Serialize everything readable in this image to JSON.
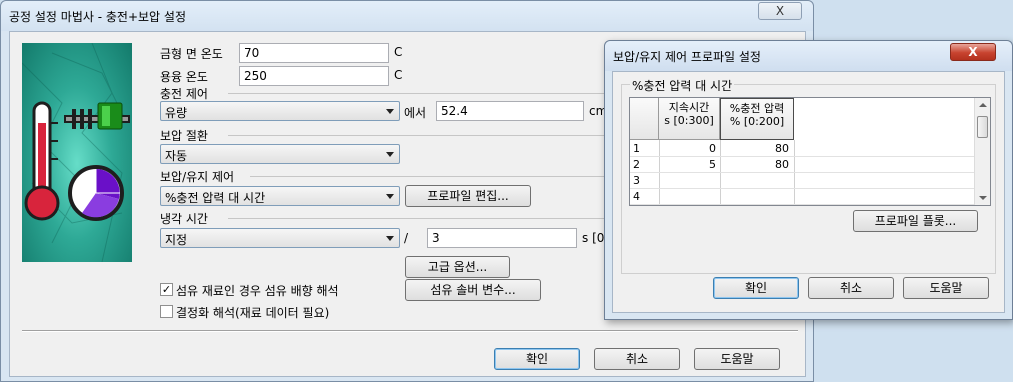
{
  "main_window": {
    "title": "공정 설정 마법사 - 충전+보압 설정",
    "close_label": "X",
    "mold_temp": {
      "label": "금형 면 온도",
      "value": "70",
      "unit": "C"
    },
    "melt_temp": {
      "label": "용융 온도",
      "value": "250",
      "unit": "C"
    },
    "fill_control": {
      "label": "충전 제어",
      "selected": "유량",
      "connector": "에서",
      "value": "52.4",
      "unit": "cm"
    },
    "vp_switch": {
      "label": "보압 절환",
      "selected": "자동"
    },
    "pack_control": {
      "label": "보압/유지 제어",
      "selected": "%충전 압력 대 시간",
      "edit_button": "프로파일 편집..."
    },
    "cooling": {
      "label": "냉각 시간",
      "selected": "지정",
      "slash": "/",
      "value": "3",
      "unit": "s [0"
    },
    "advanced_button": "고급 옵션...",
    "fiber_button": "섬유 솔버 변수...",
    "fiber_check": {
      "label": "섬유 재료인 경우 섬유 배향 해석",
      "checked": true,
      "mark": "✓"
    },
    "crystal_check": {
      "label": "결정화 해석(재료 데이터 필요)",
      "checked": false
    },
    "ok": "확인",
    "cancel": "취소",
    "help": "도움말"
  },
  "profile_dialog": {
    "title": "보압/유지 제어 프로파일 설정",
    "close_label": "X",
    "group_title": "%충전 압력 대 시간",
    "columns": [
      "지속시간\ns [0:300]",
      "%충전 압력\n% [0:200]"
    ],
    "rows": [
      {
        "index": "1",
        "duration": "0",
        "pressure": "80"
      },
      {
        "index": "2",
        "duration": "5",
        "pressure": "80"
      },
      {
        "index": "3",
        "duration": "",
        "pressure": ""
      },
      {
        "index": "4",
        "duration": "",
        "pressure": ""
      }
    ],
    "plot_button": "프로파일 플롯...",
    "ok": "확인",
    "cancel": "취소",
    "help": "도움말"
  },
  "colors": {
    "window_frame": "#d9e6f2",
    "client_bg": "#f0f0f0",
    "close_red": "#c8432f",
    "thermo_red": "#d8243c",
    "gauge_purple": "#6a10c8",
    "pic_teal": "#2ea996"
  },
  "icons": [
    "thermometer-icon",
    "clock-gauge-icon",
    "valve-icon"
  ]
}
